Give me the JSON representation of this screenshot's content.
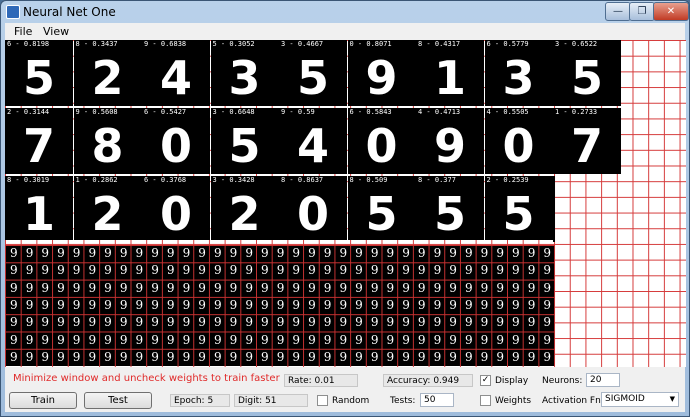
{
  "window": {
    "title": "Neural Net One",
    "min_label": "—",
    "max_label": "❐",
    "close_label": "✕"
  },
  "menu": [
    {
      "label": "File"
    },
    {
      "label": "View"
    }
  ],
  "digit_tiles": [
    {
      "label": "6 - 0.8198",
      "glyph": "5"
    },
    {
      "label": "8 - 0.3437",
      "glyph": "2"
    },
    {
      "label": "9 - 0.6838",
      "glyph": "4"
    },
    {
      "label": "5 - 0.3052",
      "glyph": "3"
    },
    {
      "label": "3 - 0.4667",
      "glyph": "5"
    },
    {
      "label": "0 - 0.8071",
      "glyph": "9"
    },
    {
      "label": "8 - 0.4317",
      "glyph": "1"
    },
    {
      "label": "6 - 0.5779",
      "glyph": "3"
    },
    {
      "label": "3 - 0.6522",
      "glyph": "5"
    },
    {
      "label": "2 - 0.3144",
      "glyph": "7"
    },
    {
      "label": "9 - 0.5608",
      "glyph": "8"
    },
    {
      "label": "6 - 0.5427",
      "glyph": "0"
    },
    {
      "label": "3 - 0.6648",
      "glyph": "5"
    },
    {
      "label": "9 - 0.59",
      "glyph": "4"
    },
    {
      "label": "6 - 0.5843",
      "glyph": "0"
    },
    {
      "label": "4 - 0.4713",
      "glyph": "9"
    },
    {
      "label": "4 - 0.5505",
      "glyph": "0"
    },
    {
      "label": "1 - 0.2733",
      "glyph": "7"
    },
    {
      "label": "8 - 0.3019",
      "glyph": "1"
    },
    {
      "label": "1 - 0.2862",
      "glyph": "2"
    },
    {
      "label": "6 - 0.3768",
      "glyph": "0"
    },
    {
      "label": "3 - 0.3428",
      "glyph": "2"
    },
    {
      "label": "8 - 0.8637",
      "glyph": "0"
    },
    {
      "label": "8 - 0.509",
      "glyph": "5"
    },
    {
      "label": "8 - 0.377",
      "glyph": "5"
    },
    {
      "label": "2 - 0.2539",
      "glyph": "5"
    }
  ],
  "weights_rows": [
    "99999999999999999999999999999999999",
    "99999999999999999999999999999999999",
    "99999999999999999999999999999999999",
    "99999999999999999999999999999999999",
    "99999999999999999999999999999999999",
    "99999999999999999999999999999999999",
    "99999999999999999999999999999999999"
  ],
  "status": {
    "message": "Minimize window and uncheck weights to train faster"
  },
  "stats": {
    "rate": "Rate: 0.01",
    "accuracy": "Accuracy: 0.949",
    "epoch": "Epoch: 5",
    "digit": "Digit: 51"
  },
  "controls": {
    "train_label": "Train",
    "test_label": "Test",
    "display_label": "Display",
    "display_checked": "✓",
    "random_label": "Random",
    "weights_label": "Weights",
    "tests_label": "Tests:",
    "tests_value": "50",
    "neurons_label": "Neurons:",
    "neurons_value": "20",
    "activation_label": "Activation Fn:",
    "activation_value": "SIGMOID"
  }
}
